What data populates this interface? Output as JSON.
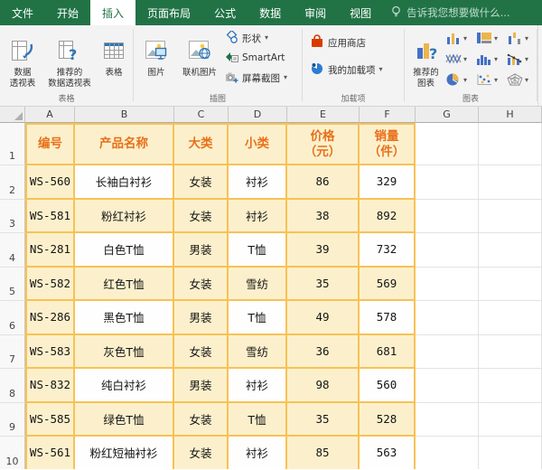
{
  "ribbon": {
    "tabs": [
      {
        "label": "文件",
        "active": false
      },
      {
        "label": "开始",
        "active": false
      },
      {
        "label": "插入",
        "active": true
      },
      {
        "label": "页面布局",
        "active": false
      },
      {
        "label": "公式",
        "active": false
      },
      {
        "label": "数据",
        "active": false
      },
      {
        "label": "审阅",
        "active": false
      },
      {
        "label": "视图",
        "active": false
      }
    ],
    "tell_me": "告诉我您想要做什么...",
    "groups": {
      "tables": {
        "label": "表格",
        "pivot": "数据\n透视表",
        "recommended_pivot": "推荐的\n数据透视表",
        "table": "表格"
      },
      "illustrations": {
        "label": "插图",
        "pictures": "图片",
        "online_pictures": "联机图片",
        "shapes": "形状",
        "smartart": "SmartArt",
        "screenshot": "屏幕截图"
      },
      "addins": {
        "label": "加载项",
        "store": "应用商店",
        "my_addins": "我的加载项"
      },
      "charts": {
        "label": "图表",
        "recommended": "推荐的\n图表",
        "chart_buttons": [
          "column-chart",
          "treemap-chart",
          "waterfall-chart",
          "line-chart",
          "histogram-chart",
          "combo-chart",
          "pie-chart",
          "scatter-chart",
          "radar-chart"
        ]
      }
    }
  },
  "sheet": {
    "column_headers": [
      "A",
      "B",
      "C",
      "D",
      "E",
      "F",
      "G",
      "H"
    ],
    "header_row": {
      "row_number": "1",
      "cells": [
        "编号",
        "产品名称",
        "大类",
        "小类",
        "价格\n（元）",
        "销量\n（件）"
      ]
    },
    "rows": [
      {
        "row_number": "2",
        "cells": [
          "WS-560",
          "长袖白衬衫",
          "女装",
          "衬衫",
          "86",
          "329"
        ]
      },
      {
        "row_number": "3",
        "cells": [
          "WS-581",
          "粉红衬衫",
          "女装",
          "衬衫",
          "38",
          "892"
        ]
      },
      {
        "row_number": "4",
        "cells": [
          "NS-281",
          "白色T恤",
          "男装",
          "T恤",
          "39",
          "732"
        ]
      },
      {
        "row_number": "5",
        "cells": [
          "WS-582",
          "红色T恤",
          "女装",
          "雪纺",
          "35",
          "569"
        ]
      },
      {
        "row_number": "6",
        "cells": [
          "NS-286",
          "黑色T恤",
          "男装",
          "T恤",
          "49",
          "578"
        ]
      },
      {
        "row_number": "7",
        "cells": [
          "WS-583",
          "灰色T恤",
          "女装",
          "雪纺",
          "36",
          "681"
        ]
      },
      {
        "row_number": "8",
        "cells": [
          "NS-832",
          "纯白衬衫",
          "男装",
          "衬衫",
          "98",
          "560"
        ]
      },
      {
        "row_number": "9",
        "cells": [
          "WS-585",
          "绿色T恤",
          "女装",
          "T恤",
          "35",
          "528"
        ]
      },
      {
        "row_number": "10",
        "cells": [
          "WS-561",
          "粉红短袖衬衫",
          "女装",
          "衬衫",
          "85",
          "563"
        ]
      }
    ]
  },
  "colors": {
    "excel_green": "#217346",
    "table_border_gold": "#F7C254",
    "cell_cream": "#FCF0CC",
    "header_text_orange": "#E8701A",
    "chart_icon_blue": "#4472C4",
    "chart_icon_yellow": "#EDB54C"
  }
}
